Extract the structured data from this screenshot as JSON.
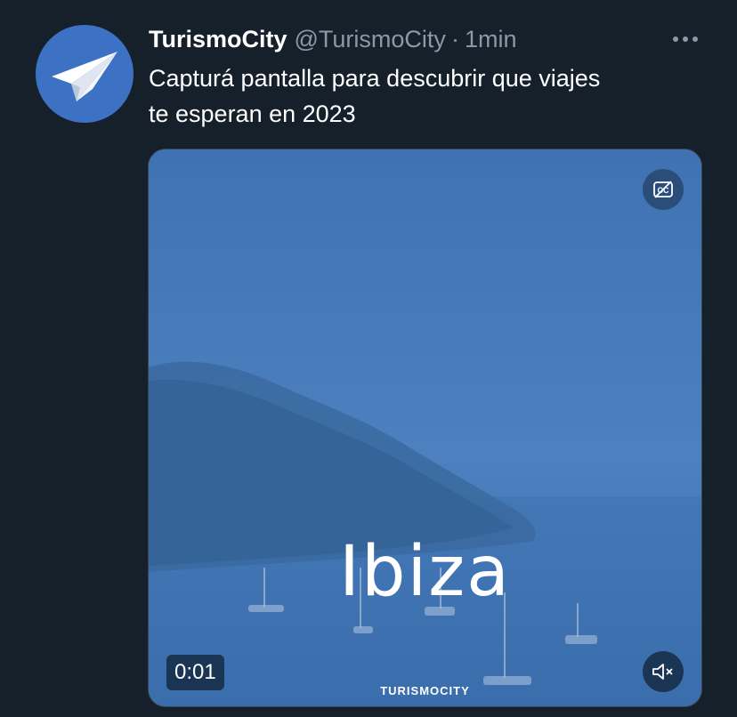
{
  "tweet": {
    "author": {
      "display_name": "TurismoCity",
      "handle": "@TurismoCity",
      "separator": "·",
      "timestamp": "1min",
      "avatar_icon": "paper-plane-icon",
      "avatar_color": "#3c71c4"
    },
    "more_icon": "more-horizontal-icon",
    "text": "Capturá pantalla para descubrir que viajes\nte esperan en 2023",
    "media": {
      "type": "video",
      "overlay_text": "Ibiza",
      "watermark": "TURISMOCITY",
      "elapsed_time": "0:01",
      "captions_icon": "captions-off-icon",
      "volume_icon": "volume-muted-icon",
      "tint_color": "#4478b5"
    }
  },
  "colors": {
    "background": "#15202b",
    "primary_text": "#ffffff",
    "secondary_text": "#8b98a5",
    "border": "#38444d"
  }
}
